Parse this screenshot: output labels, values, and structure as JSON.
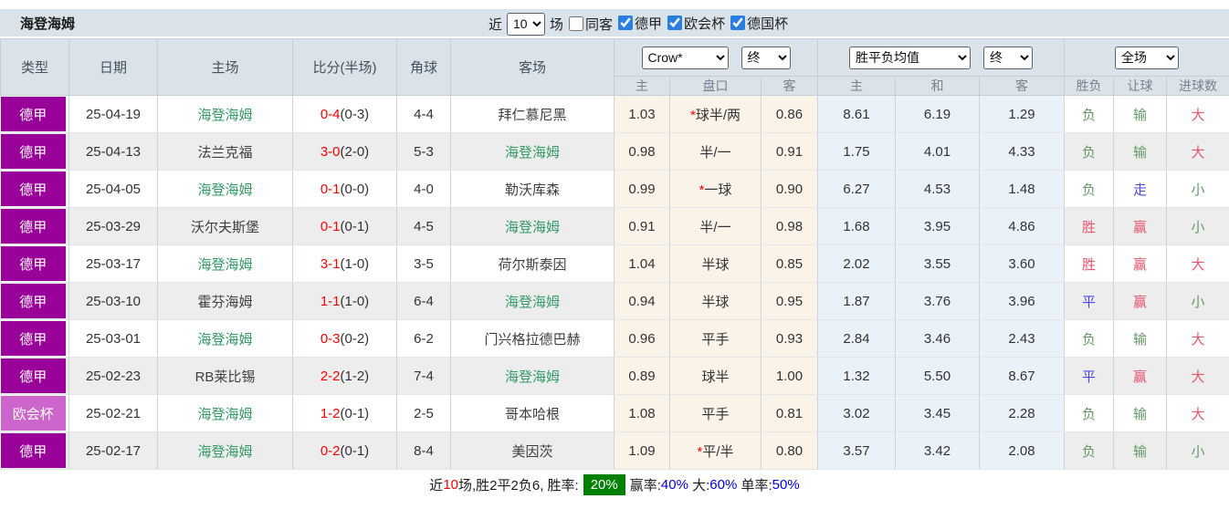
{
  "title": "海登海姆",
  "toolbar": {
    "near_label": "近",
    "near_value": "10",
    "games_label": "场",
    "same_opponent": {
      "label": "同客",
      "checked": false
    },
    "leagues": [
      {
        "label": "德甲",
        "checked": true
      },
      {
        "label": "欧会杯",
        "checked": true
      },
      {
        "label": "德国杯",
        "checked": true
      }
    ]
  },
  "header": {
    "static_columns": [
      "类型",
      "日期",
      "主场",
      "比分(半场)",
      "角球",
      "客场"
    ],
    "odds_source_select": "Crow*",
    "odds_final_select": "终",
    "avg_select": "胜平负均值",
    "avg_final_select": "终",
    "scope_select": "全场",
    "odds_sub": [
      "主",
      "盘口",
      "客"
    ],
    "avg_sub": [
      "主",
      "和",
      "客"
    ],
    "result_sub": [
      "胜负",
      "让球",
      "进球数"
    ]
  },
  "colors": {
    "league_primary": "#990099",
    "league_europa": "#cc66cc",
    "self_team": "#339966",
    "score_red": "#ff0000",
    "result_red": "#e9546b",
    "result_blue": "#4a4ae0",
    "result_green": "#669966",
    "rate_badge_bg": "#008000",
    "rate_value_blue": "#0000dd"
  },
  "rows": [
    {
      "league": "德甲",
      "league_kind": "primary",
      "date": "25-04-19",
      "home": "海登海姆",
      "home_self": true,
      "score_full": "0-4",
      "score_half": "(0-3)",
      "corners": "4-4",
      "away": "拜仁慕尼黑",
      "away_self": false,
      "odds_home": "1.03",
      "handicap_star": true,
      "handicap": "球半/两",
      "odds_away": "0.86",
      "avg_home": "8.61",
      "avg_draw": "6.19",
      "avg_away": "1.29",
      "result_wdl": {
        "t": "负",
        "c": "green"
      },
      "result_handicap": {
        "t": "输",
        "c": "green"
      },
      "result_goals": {
        "t": "大",
        "c": "red"
      }
    },
    {
      "league": "德甲",
      "league_kind": "primary",
      "date": "25-04-13",
      "home": "法兰克福",
      "home_self": false,
      "score_full": "3-0",
      "score_half": "(2-0)",
      "corners": "5-3",
      "away": "海登海姆",
      "away_self": true,
      "odds_home": "0.98",
      "handicap_star": false,
      "handicap": "半/一",
      "odds_away": "0.91",
      "avg_home": "1.75",
      "avg_draw": "4.01",
      "avg_away": "4.33",
      "result_wdl": {
        "t": "负",
        "c": "green"
      },
      "result_handicap": {
        "t": "输",
        "c": "green"
      },
      "result_goals": {
        "t": "大",
        "c": "red"
      }
    },
    {
      "league": "德甲",
      "league_kind": "primary",
      "date": "25-04-05",
      "home": "海登海姆",
      "home_self": true,
      "score_full": "0-1",
      "score_half": "(0-0)",
      "corners": "4-0",
      "away": "勒沃库森",
      "away_self": false,
      "odds_home": "0.99",
      "handicap_star": true,
      "handicap": "一球",
      "odds_away": "0.90",
      "avg_home": "6.27",
      "avg_draw": "4.53",
      "avg_away": "1.48",
      "result_wdl": {
        "t": "负",
        "c": "green"
      },
      "result_handicap": {
        "t": "走",
        "c": "blue"
      },
      "result_goals": {
        "t": "小",
        "c": "green"
      }
    },
    {
      "league": "德甲",
      "league_kind": "primary",
      "date": "25-03-29",
      "home": "沃尔夫斯堡",
      "home_self": false,
      "score_full": "0-1",
      "score_half": "(0-1)",
      "corners": "4-5",
      "away": "海登海姆",
      "away_self": true,
      "odds_home": "0.91",
      "handicap_star": false,
      "handicap": "半/一",
      "odds_away": "0.98",
      "avg_home": "1.68",
      "avg_draw": "3.95",
      "avg_away": "4.86",
      "result_wdl": {
        "t": "胜",
        "c": "red"
      },
      "result_handicap": {
        "t": "赢",
        "c": "red"
      },
      "result_goals": {
        "t": "小",
        "c": "green"
      }
    },
    {
      "league": "德甲",
      "league_kind": "primary",
      "date": "25-03-17",
      "home": "海登海姆",
      "home_self": true,
      "score_full": "3-1",
      "score_half": "(1-0)",
      "corners": "3-5",
      "away": "荷尔斯泰因",
      "away_self": false,
      "odds_home": "1.04",
      "handicap_star": false,
      "handicap": "半球",
      "odds_away": "0.85",
      "avg_home": "2.02",
      "avg_draw": "3.55",
      "avg_away": "3.60",
      "result_wdl": {
        "t": "胜",
        "c": "red"
      },
      "result_handicap": {
        "t": "赢",
        "c": "red"
      },
      "result_goals": {
        "t": "大",
        "c": "red"
      }
    },
    {
      "league": "德甲",
      "league_kind": "primary",
      "date": "25-03-10",
      "home": "霍芬海姆",
      "home_self": false,
      "score_full": "1-1",
      "score_half": "(1-0)",
      "corners": "6-4",
      "away": "海登海姆",
      "away_self": true,
      "odds_home": "0.94",
      "handicap_star": false,
      "handicap": "半球",
      "odds_away": "0.95",
      "avg_home": "1.87",
      "avg_draw": "3.76",
      "avg_away": "3.96",
      "result_wdl": {
        "t": "平",
        "c": "blue"
      },
      "result_handicap": {
        "t": "赢",
        "c": "red"
      },
      "result_goals": {
        "t": "小",
        "c": "green"
      }
    },
    {
      "league": "德甲",
      "league_kind": "primary",
      "date": "25-03-01",
      "home": "海登海姆",
      "home_self": true,
      "score_full": "0-3",
      "score_half": "(0-2)",
      "corners": "6-2",
      "away": "门兴格拉德巴赫",
      "away_self": false,
      "odds_home": "0.96",
      "handicap_star": false,
      "handicap": "平手",
      "odds_away": "0.93",
      "avg_home": "2.84",
      "avg_draw": "3.46",
      "avg_away": "2.43",
      "result_wdl": {
        "t": "负",
        "c": "green"
      },
      "result_handicap": {
        "t": "输",
        "c": "green"
      },
      "result_goals": {
        "t": "大",
        "c": "red"
      }
    },
    {
      "league": "德甲",
      "league_kind": "primary",
      "date": "25-02-23",
      "home": "RB莱比锡",
      "home_self": false,
      "score_full": "2-2",
      "score_half": "(1-2)",
      "corners": "7-4",
      "away": "海登海姆",
      "away_self": true,
      "odds_home": "0.89",
      "handicap_star": false,
      "handicap": "球半",
      "odds_away": "1.00",
      "avg_home": "1.32",
      "avg_draw": "5.50",
      "avg_away": "8.67",
      "result_wdl": {
        "t": "平",
        "c": "blue"
      },
      "result_handicap": {
        "t": "赢",
        "c": "red"
      },
      "result_goals": {
        "t": "大",
        "c": "red"
      }
    },
    {
      "league": "欧会杯",
      "league_kind": "europa",
      "date": "25-02-21",
      "home": "海登海姆",
      "home_self": true,
      "score_full": "1-2",
      "score_half": "(0-1)",
      "corners": "2-5",
      "away": "哥本哈根",
      "away_self": false,
      "odds_home": "1.08",
      "handicap_star": false,
      "handicap": "平手",
      "odds_away": "0.81",
      "avg_home": "3.02",
      "avg_draw": "3.45",
      "avg_away": "2.28",
      "result_wdl": {
        "t": "负",
        "c": "green"
      },
      "result_handicap": {
        "t": "输",
        "c": "green"
      },
      "result_goals": {
        "t": "大",
        "c": "red"
      }
    },
    {
      "league": "德甲",
      "league_kind": "primary",
      "date": "25-02-17",
      "home": "海登海姆",
      "home_self": true,
      "score_full": "0-2",
      "score_half": "(0-1)",
      "corners": "8-4",
      "away": "美因茨",
      "away_self": false,
      "odds_home": "1.09",
      "handicap_star": true,
      "handicap": "平/半",
      "odds_away": "0.80",
      "avg_home": "3.57",
      "avg_draw": "3.42",
      "avg_away": "2.08",
      "result_wdl": {
        "t": "负",
        "c": "green"
      },
      "result_handicap": {
        "t": "输",
        "c": "green"
      },
      "result_goals": {
        "t": "小",
        "c": "green"
      }
    }
  ],
  "footer": {
    "segments": [
      {
        "text": "近",
        "style": "plain"
      },
      {
        "text": "10",
        "style": "red"
      },
      {
        "text": "场,胜2平2负6, 胜率:",
        "style": "plain"
      },
      {
        "text": "20%",
        "style": "badge"
      },
      {
        "text": "赢率:",
        "style": "plain"
      },
      {
        "text": "40%",
        "style": "blue"
      },
      {
        "text": " 大:",
        "style": "plain"
      },
      {
        "text": "60%",
        "style": "blue"
      },
      {
        "text": " 单率:",
        "style": "plain"
      },
      {
        "text": "50%",
        "style": "blue"
      }
    ]
  }
}
